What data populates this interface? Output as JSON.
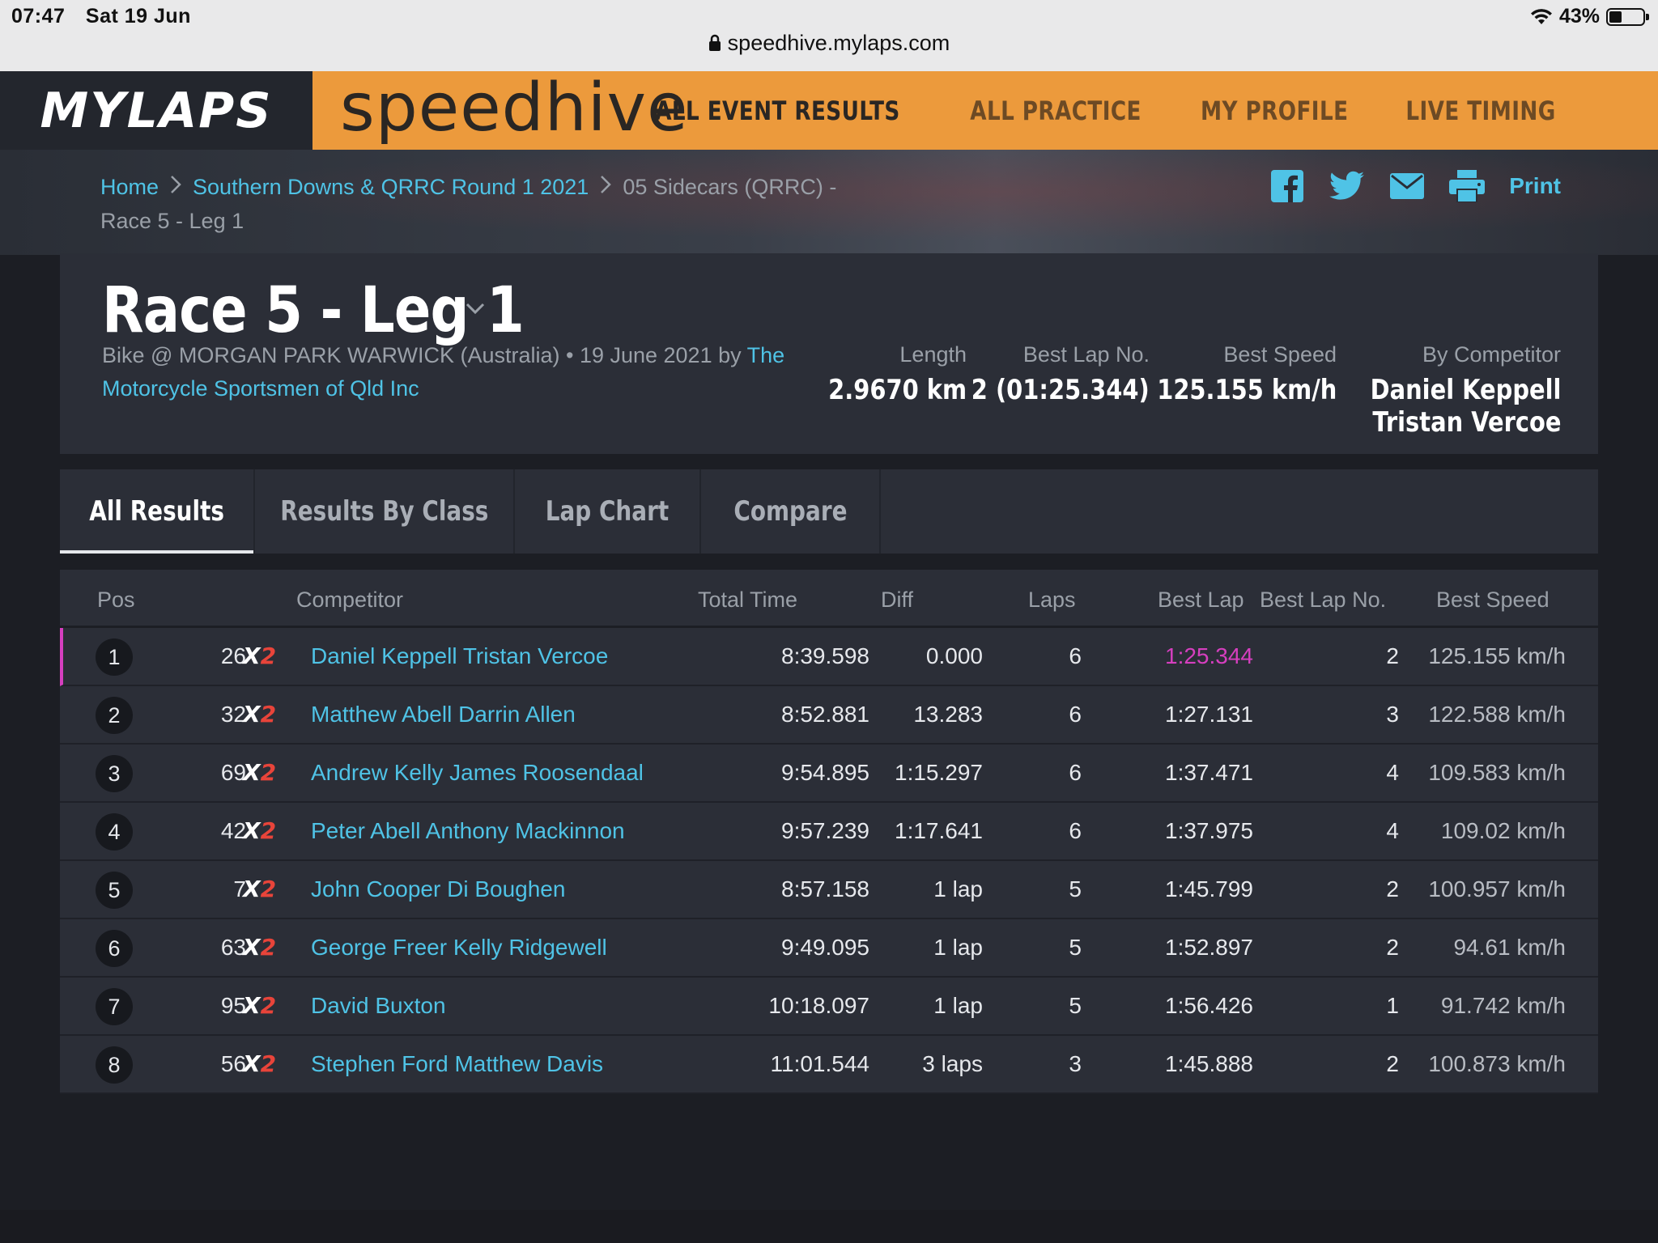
{
  "status": {
    "time": "07:47",
    "date": "Sat 19 Jun",
    "battery": "43%",
    "battery_level": 0.43
  },
  "browser": {
    "url": "speedhive.mylaps.com"
  },
  "header": {
    "brand": "MYLAPS",
    "product": "speedhive",
    "nav": [
      {
        "label": "ALL EVENT RESULTS",
        "active": true
      },
      {
        "label": "ALL PRACTICE",
        "active": false
      },
      {
        "label": "MY PROFILE",
        "active": false
      },
      {
        "label": "LIVE TIMING",
        "active": false
      }
    ]
  },
  "breadcrumb": {
    "home": "Home",
    "event": "Southern Downs & QRRC Round 1 2021",
    "session": "05 Sidecars (QRRC) -",
    "current": "Race 5 - Leg 1"
  },
  "share": {
    "print_label": "Print"
  },
  "race": {
    "title": "Race 5 - Leg 1",
    "meta": "Bike @ MORGAN PARK WARWICK (Australia) • 19 June 2021 by ",
    "organizer": "The Motorcycle Sportsmen of Qld Inc",
    "stats": {
      "length_label": "Length",
      "length": "2.9670 km",
      "bestlapno_label": "Best Lap No.",
      "bestlapno": "2 (01:25.344)",
      "bestspeed_label": "Best Speed",
      "bestspeed": "125.155 km/h",
      "bycomp_label": "By Competitor",
      "bycomp_line1": "Daniel Keppell",
      "bycomp_line2": "Tristan Vercoe"
    }
  },
  "tabs": [
    "All Results",
    "Results By Class",
    "Lap Chart",
    "Compare"
  ],
  "table": {
    "headers": {
      "pos": "Pos",
      "competitor": "Competitor",
      "total": "Total Time",
      "diff": "Diff",
      "laps": "Laps",
      "bestlap": "Best Lap",
      "bestlapno": "Best Lap No.",
      "bestspeed": "Best Speed"
    },
    "class_label": "X",
    "class_num": "2",
    "rows": [
      {
        "pos": "1",
        "num": "26",
        "name": "Daniel Keppell Tristan Vercoe",
        "total": "8:39.598",
        "diff": "0.000",
        "laps": "6",
        "bestlap": "1:25.344",
        "bestlapno": "2",
        "speed": "125.155 km/h"
      },
      {
        "pos": "2",
        "num": "32",
        "name": "Matthew Abell Darrin Allen",
        "total": "8:52.881",
        "diff": "13.283",
        "laps": "6",
        "bestlap": "1:27.131",
        "bestlapno": "3",
        "speed": "122.588 km/h"
      },
      {
        "pos": "3",
        "num": "69",
        "name": "Andrew Kelly James Roosendaal",
        "total": "9:54.895",
        "diff": "1:15.297",
        "laps": "6",
        "bestlap": "1:37.471",
        "bestlapno": "4",
        "speed": "109.583 km/h"
      },
      {
        "pos": "4",
        "num": "42",
        "name": "Peter Abell Anthony Mackinnon",
        "total": "9:57.239",
        "diff": "1:17.641",
        "laps": "6",
        "bestlap": "1:37.975",
        "bestlapno": "4",
        "speed": "109.02 km/h"
      },
      {
        "pos": "5",
        "num": "7",
        "name": "John Cooper Di Boughen",
        "total": "8:57.158",
        "diff": "1 lap",
        "laps": "5",
        "bestlap": "1:45.799",
        "bestlapno": "2",
        "speed": "100.957 km/h"
      },
      {
        "pos": "6",
        "num": "63",
        "name": "George Freer Kelly Ridgewell",
        "total": "9:49.095",
        "diff": "1 lap",
        "laps": "5",
        "bestlap": "1:52.897",
        "bestlapno": "2",
        "speed": "94.61 km/h"
      },
      {
        "pos": "7",
        "num": "95",
        "name": "David Buxton",
        "total": "10:18.097",
        "diff": "1 lap",
        "laps": "5",
        "bestlap": "1:56.426",
        "bestlapno": "1",
        "speed": "91.742 km/h"
      },
      {
        "pos": "8",
        "num": "56",
        "name": "Stephen Ford Matthew Davis",
        "total": "11:01.544",
        "diff": "3 laps",
        "laps": "3",
        "bestlap": "1:45.888",
        "bestlapno": "2",
        "speed": "100.873 km/h"
      }
    ]
  },
  "colors": {
    "accent": "#ec9a3c",
    "link": "#4fc3e6",
    "best": "#d63fbf",
    "class_red": "#e8443a"
  }
}
